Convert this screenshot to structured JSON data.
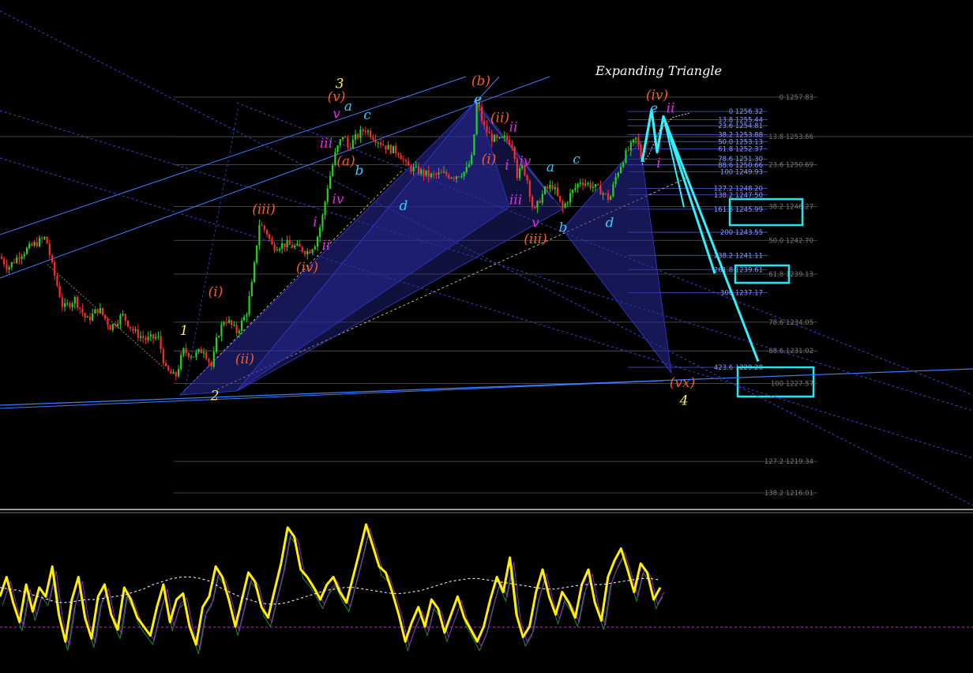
{
  "chart_data": {
    "type": "candlestick",
    "title": "Expanding Triangle",
    "ylim": [
      1215,
      1260
    ],
    "main_levels": [
      {
        "label": "0 1257.83",
        "value": 1257.83
      },
      {
        "label": "13.8 1253.66",
        "value": 1253.66
      },
      {
        "label": "23.6 1250.69",
        "value": 1250.69
      },
      {
        "label": "38.2 1246.27",
        "value": 1246.27
      },
      {
        "label": "50.0 1242.70",
        "value": 1242.7
      },
      {
        "label": "61.8 1239.13",
        "value": 1239.13
      },
      {
        "label": "78.6 1234.05",
        "value": 1234.05
      },
      {
        "label": "88.6 1231.02",
        "value": 1231.02
      },
      {
        "label": "100 1227.57",
        "value": 1227.57
      },
      {
        "label": "127.2 1219.34",
        "value": 1219.34
      },
      {
        "label": "138.2 1216.01",
        "value": 1216.01
      }
    ],
    "upper_levels": [
      {
        "label": "0 1256.32",
        "value": 1256.32
      },
      {
        "label": "13.8 1255.44",
        "value": 1255.44
      },
      {
        "label": "23.6 1254.81",
        "value": 1254.81
      },
      {
        "label": "38.2 1253.88",
        "value": 1253.88
      },
      {
        "label": "50.0 1253.13",
        "value": 1253.13
      },
      {
        "label": "61.8 1252.37",
        "value": 1252.37
      },
      {
        "label": "78.6 1251.30",
        "value": 1251.3
      },
      {
        "label": "88.6 1250.66",
        "value": 1250.66
      },
      {
        "label": "100 1249.93",
        "value": 1249.93
      },
      {
        "label": "127.2 1248.20",
        "value": 1248.2
      },
      {
        "label": "138.2 1247.50",
        "value": 1247.5
      },
      {
        "label": "161.8 1245.99",
        "value": 1245.99
      },
      {
        "label": "200 1243.55",
        "value": 1243.55
      },
      {
        "label": "238.2 1241.11",
        "value": 1241.11
      },
      {
        "label": "261.8 1239.61",
        "value": 1239.61
      },
      {
        "label": "300 1237.17",
        "value": 1237.17
      },
      {
        "label": "423.6 1229.28",
        "value": 1229.28
      }
    ],
    "highlighted_targets": [
      "161.8 1245.99",
      "261.8 1239.61",
      "423.6 1229.28"
    ],
    "price_path": [
      [
        0,
        1241.0
      ],
      [
        10,
        1239.8
      ],
      [
        25,
        1241.2
      ],
      [
        42,
        1242.2
      ],
      [
        58,
        1243.0
      ],
      [
        66,
        1240.0
      ],
      [
        80,
        1235.5
      ],
      [
        95,
        1236.5
      ],
      [
        110,
        1234.2
      ],
      [
        125,
        1235.5
      ],
      [
        140,
        1233.5
      ],
      [
        155,
        1234.8
      ],
      [
        170,
        1233.0
      ],
      [
        185,
        1232.2
      ],
      [
        200,
        1232.5
      ],
      [
        210,
        1229.0
      ],
      [
        222,
        1228.2
      ],
      [
        232,
        1231.0
      ],
      [
        245,
        1230.5
      ],
      [
        258,
        1231.2
      ],
      [
        268,
        1229.3
      ],
      [
        275,
        1232.5
      ],
      [
        285,
        1234.5
      ],
      [
        300,
        1233.0
      ],
      [
        312,
        1235.0
      ],
      [
        320,
        1238.5
      ],
      [
        328,
        1244.5
      ],
      [
        338,
        1243.5
      ],
      [
        345,
        1242.0
      ],
      [
        360,
        1242.3
      ],
      [
        375,
        1242.0
      ],
      [
        390,
        1241.5
      ],
      [
        400,
        1242.5
      ],
      [
        408,
        1245.0
      ],
      [
        415,
        1248.5
      ],
      [
        425,
        1252.0
      ],
      [
        435,
        1254.0
      ],
      [
        440,
        1252.5
      ],
      [
        450,
        1253.5
      ],
      [
        462,
        1254.5
      ],
      [
        475,
        1253.5
      ],
      [
        490,
        1252.5
      ],
      [
        505,
        1252.0
      ],
      [
        515,
        1250.5
      ],
      [
        530,
        1250.0
      ],
      [
        545,
        1249.5
      ],
      [
        560,
        1249.7
      ],
      [
        575,
        1249.5
      ],
      [
        590,
        1250.0
      ],
      [
        598,
        1251.5
      ],
      [
        604,
        1257.5
      ],
      [
        612,
        1254.8
      ],
      [
        622,
        1253.5
      ],
      [
        632,
        1253.2
      ],
      [
        640,
        1253.5
      ],
      [
        650,
        1252.8
      ],
      [
        655,
        1249.5
      ],
      [
        662,
        1250.5
      ],
      [
        668,
        1249.0
      ],
      [
        676,
        1245.5
      ],
      [
        682,
        1246.8
      ],
      [
        690,
        1248.0
      ],
      [
        700,
        1248.5
      ],
      [
        712,
        1246.0
      ],
      [
        722,
        1247.5
      ],
      [
        735,
        1249.0
      ],
      [
        748,
        1248.5
      ],
      [
        760,
        1248.0
      ],
      [
        772,
        1247.0
      ],
      [
        780,
        1249.5
      ],
      [
        790,
        1251.5
      ],
      [
        798,
        1252.5
      ],
      [
        806,
        1253.5
      ],
      [
        813,
        1251.0
      ],
      [
        818,
        1252.5
      ]
    ],
    "projection_paths": [
      [
        [
          813,
          1251.0
        ],
        [
          825,
          1256.5
        ],
        [
          832,
          1252.0
        ],
        [
          840,
          1255.8
        ],
        [
          866,
          1246.2
        ]
      ],
      [
        [
          813,
          1251.0
        ],
        [
          825,
          1256.5
        ],
        [
          832,
          1252.0
        ],
        [
          840,
          1255.8
        ],
        [
          905,
          1239.2
        ]
      ],
      [
        [
          813,
          1251.0
        ],
        [
          825,
          1256.5
        ],
        [
          832,
          1252.0
        ],
        [
          840,
          1255.8
        ],
        [
          960,
          1229.9
        ]
      ]
    ],
    "wave_labels": [
      {
        "text": "1",
        "x": 233,
        "y": 1232.7,
        "color": "#ffee55"
      },
      {
        "text": "2",
        "x": 272,
        "y": 1225.8,
        "color": "#ffee55"
      },
      {
        "text": "3",
        "x": 430,
        "y": 1258.8,
        "color": "#ffee55"
      },
      {
        "text": "4",
        "x": 866,
        "y": 1225.3,
        "color": "#ffee55"
      },
      {
        "text": "(i)",
        "x": 273,
        "y": 1236.8,
        "color": "#ff5a1f"
      },
      {
        "text": "(ii)",
        "x": 310,
        "y": 1229.7,
        "color": "#ff5a1f"
      },
      {
        "text": "(iii)",
        "x": 334,
        "y": 1245.5,
        "color": "#ff5a1f"
      },
      {
        "text": "(iv)",
        "x": 389,
        "y": 1239.4,
        "color": "#ff5a1f"
      },
      {
        "text": "(v)",
        "x": 426,
        "y": 1257.4,
        "color": "#ff5a1f"
      },
      {
        "text": "(a)",
        "x": 438,
        "y": 1250.6,
        "color": "#ff5a1f"
      },
      {
        "text": "(b)",
        "x": 609,
        "y": 1259.1,
        "color": "#ff5a1f"
      },
      {
        "text": "(i)",
        "x": 619,
        "y": 1250.8,
        "color": "#ff5a1f"
      },
      {
        "text": "(ii)",
        "x": 633,
        "y": 1255.2,
        "color": "#ff5a1f"
      },
      {
        "text": "(iii)",
        "x": 678,
        "y": 1242.4,
        "color": "#ff5a1f"
      },
      {
        "text": "(iv)",
        "x": 832,
        "y": 1257.6,
        "color": "#ff5a1f"
      },
      {
        "text": "(vx)",
        "x": 864,
        "y": 1227.2,
        "color": "#ff5a1f"
      },
      {
        "text": "a",
        "x": 441,
        "y": 1256.4,
        "color": "#36c9ff"
      },
      {
        "text": "b",
        "x": 455,
        "y": 1249.6,
        "color": "#36c9ff"
      },
      {
        "text": "c",
        "x": 465,
        "y": 1255.5,
        "color": "#36c9ff"
      },
      {
        "text": "d",
        "x": 511,
        "y": 1245.9,
        "color": "#36c9ff"
      },
      {
        "text": "e",
        "x": 605,
        "y": 1257.1,
        "color": "#36c9ff"
      },
      {
        "text": "a",
        "x": 697,
        "y": 1250.0,
        "color": "#36c9ff"
      },
      {
        "text": "b",
        "x": 713,
        "y": 1243.6,
        "color": "#36c9ff"
      },
      {
        "text": "c",
        "x": 730,
        "y": 1250.8,
        "color": "#36c9ff"
      },
      {
        "text": "d",
        "x": 772,
        "y": 1244.1,
        "color": "#36c9ff"
      },
      {
        "text": "e",
        "x": 828,
        "y": 1256.2,
        "color": "#36c9ff"
      },
      {
        "text": "v",
        "x": 426,
        "y": 1255.6,
        "color": "#e02ee0"
      },
      {
        "text": "iii",
        "x": 413,
        "y": 1252.5,
        "color": "#e02ee0"
      },
      {
        "text": "iv",
        "x": 428,
        "y": 1246.6,
        "color": "#e02ee0"
      },
      {
        "text": "i",
        "x": 399,
        "y": 1244.2,
        "color": "#e02ee0"
      },
      {
        "text": "ii",
        "x": 413,
        "y": 1241.7,
        "color": "#e02ee0"
      },
      {
        "text": "ii",
        "x": 650,
        "y": 1254.2,
        "color": "#e02ee0"
      },
      {
        "text": "i",
        "x": 642,
        "y": 1250.2,
        "color": "#e02ee0"
      },
      {
        "text": "iv",
        "x": 665,
        "y": 1250.6,
        "color": "#e02ee0"
      },
      {
        "text": "iii",
        "x": 653,
        "y": 1246.5,
        "color": "#e02ee0"
      },
      {
        "text": "v",
        "x": 678,
        "y": 1244.1,
        "color": "#e02ee0"
      },
      {
        "text": "ii",
        "x": 849,
        "y": 1256.2,
        "color": "#e02ee0"
      },
      {
        "text": "i",
        "x": 834,
        "y": 1250.4,
        "color": "#e02ee0"
      }
    ]
  },
  "oscillator": {
    "values": [
      42,
      55,
      38,
      25,
      50,
      32,
      48,
      42,
      62,
      30,
      12,
      40,
      55,
      28,
      14,
      42,
      50,
      30,
      20,
      48,
      40,
      28,
      22,
      16,
      35,
      50,
      25,
      40,
      44,
      22,
      10,
      35,
      42,
      62,
      55,
      40,
      22,
      40,
      58,
      52,
      35,
      28,
      46,
      64,
      88,
      82,
      60,
      55,
      48,
      40,
      50,
      55,
      45,
      38,
      55,
      72,
      90,
      76,
      62,
      58,
      45,
      30,
      12,
      25,
      35,
      22,
      40,
      34,
      18,
      30,
      42,
      28,
      20,
      12,
      22,
      40,
      55,
      45,
      68,
      30,
      15,
      22,
      45,
      60,
      42,
      30,
      45,
      38,
      28,
      50,
      60,
      38,
      26,
      55,
      66,
      74,
      60,
      45,
      64,
      58,
      40,
      48
    ],
    "signal_dashes": [
      48,
      47,
      46,
      44,
      42,
      40,
      38,
      38,
      39,
      40,
      40,
      41,
      42,
      43,
      45,
      47,
      50,
      52,
      54,
      55,
      55,
      54,
      52,
      48,
      45,
      42,
      40,
      38,
      37,
      37,
      38,
      40,
      42,
      44,
      46,
      47,
      48,
      48,
      47,
      46,
      45,
      44,
      44,
      45,
      46,
      48,
      50,
      52,
      53,
      54,
      54,
      53,
      52,
      51,
      50,
      49,
      48,
      47,
      47,
      48,
      49,
      50,
      50,
      50,
      51,
      52,
      53,
      54,
      54,
      53
    ]
  }
}
